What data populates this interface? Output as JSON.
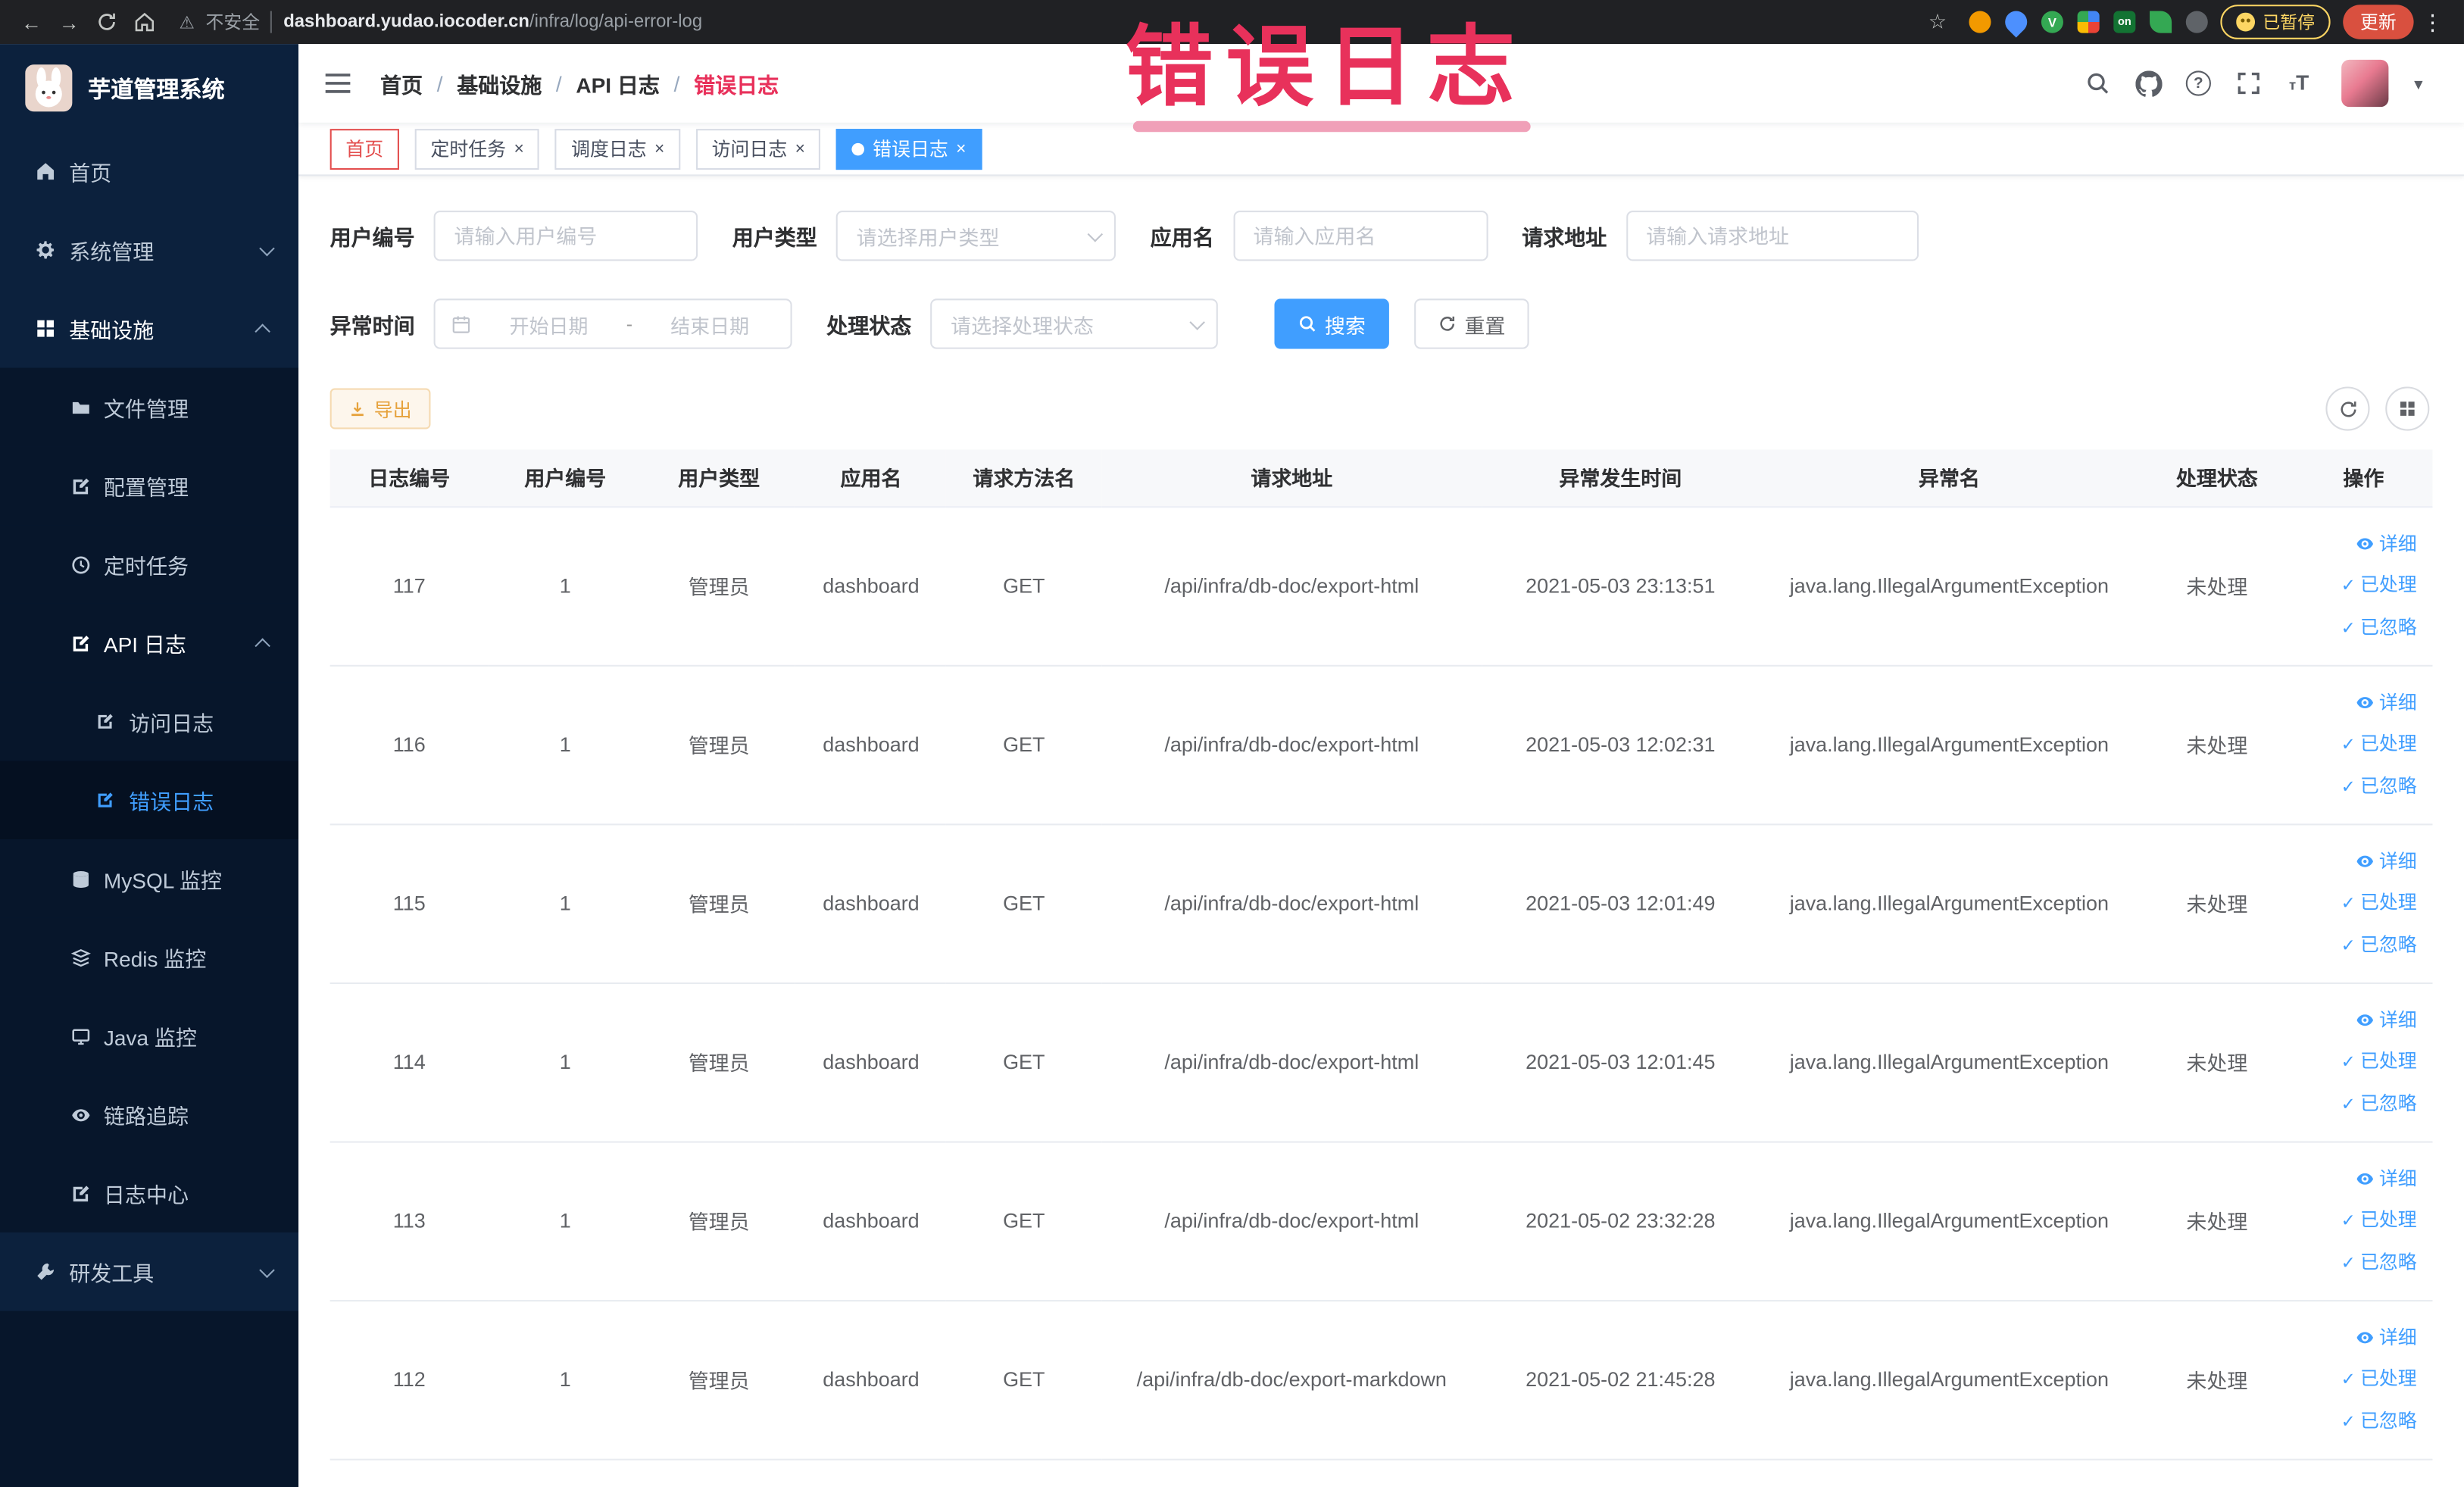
{
  "colors": {
    "accent": "#409eff",
    "annotation": "#e8315b",
    "warning": "#e6a23c",
    "sidebar-bg": "#0c213d",
    "sidebar-sub-bg": "#07162b"
  },
  "annotation": {
    "title": "错误日志"
  },
  "browser": {
    "security_label": "不安全",
    "url_host": "dashboard.yudao.iocoder.cn",
    "url_path": "/infra/log/api-error-log",
    "extension_on_badge": "on",
    "paused_badge": "已暂停",
    "update_label": "更新"
  },
  "sidebar": {
    "logo_title": "芋道管理系统",
    "home": "首页",
    "system_mgmt": "系统管理",
    "infrastructure": "基础设施",
    "file_mgmt": "文件管理",
    "config_mgmt": "配置管理",
    "scheduled_jobs": "定时任务",
    "api_log": "API 日志",
    "access_log": "访问日志",
    "error_log": "错误日志",
    "mysql_monitor": "MySQL 监控",
    "redis_monitor": "Redis 监控",
    "java_monitor": "Java 监控",
    "tracing": "链路追踪",
    "log_center": "日志中心",
    "dev_tools": "研发工具"
  },
  "breadcrumb": {
    "separator": "/",
    "items": [
      "首页",
      "基础设施",
      "API 日志",
      "错误日志"
    ]
  },
  "tags": {
    "home": "首页",
    "job": "定时任务",
    "job_log": "调度日志",
    "access_log": "访问日志",
    "error_log": "错误日志"
  },
  "filters": {
    "user_id": {
      "label": "用户编号",
      "placeholder": "请输入用户编号"
    },
    "user_type": {
      "label": "用户类型",
      "placeholder": "请选择用户类型"
    },
    "app_name": {
      "label": "应用名",
      "placeholder": "请输入应用名"
    },
    "request_url": {
      "label": "请求地址",
      "placeholder": "请输入请求地址"
    },
    "exception_time": {
      "label": "异常时间",
      "start_placeholder": "开始日期",
      "end_placeholder": "结束日期",
      "separator": "-"
    },
    "process_status": {
      "label": "处理状态",
      "placeholder": "请选择处理状态"
    },
    "search_label": "搜索",
    "reset_label": "重置"
  },
  "toolbar": {
    "export_label": "导出"
  },
  "table": {
    "columns": [
      "日志编号",
      "用户编号",
      "用户类型",
      "应用名",
      "请求方法名",
      "请求地址",
      "异常发生时间",
      "异常名",
      "处理状态",
      "操作"
    ],
    "actions": {
      "detail": "详细",
      "processed": "已处理",
      "ignored": "已忽略"
    },
    "rows": [
      {
        "id": "117",
        "user_id": "1",
        "user_type": "管理员",
        "app_name": "dashboard",
        "method": "GET",
        "url": "/api/infra/db-doc/export-html",
        "time": "2021-05-03 23:13:51",
        "exception": "java.lang.IllegalArgumentException",
        "status": "未处理"
      },
      {
        "id": "116",
        "user_id": "1",
        "user_type": "管理员",
        "app_name": "dashboard",
        "method": "GET",
        "url": "/api/infra/db-doc/export-html",
        "time": "2021-05-03 12:02:31",
        "exception": "java.lang.IllegalArgumentException",
        "status": "未处理"
      },
      {
        "id": "115",
        "user_id": "1",
        "user_type": "管理员",
        "app_name": "dashboard",
        "method": "GET",
        "url": "/api/infra/db-doc/export-html",
        "time": "2021-05-03 12:01:49",
        "exception": "java.lang.IllegalArgumentException",
        "status": "未处理"
      },
      {
        "id": "114",
        "user_id": "1",
        "user_type": "管理员",
        "app_name": "dashboard",
        "method": "GET",
        "url": "/api/infra/db-doc/export-html",
        "time": "2021-05-03 12:01:45",
        "exception": "java.lang.IllegalArgumentException",
        "status": "未处理"
      },
      {
        "id": "113",
        "user_id": "1",
        "user_type": "管理员",
        "app_name": "dashboard",
        "method": "GET",
        "url": "/api/infra/db-doc/export-html",
        "time": "2021-05-02 23:32:28",
        "exception": "java.lang.IllegalArgumentException",
        "status": "未处理"
      },
      {
        "id": "112",
        "user_id": "1",
        "user_type": "管理员",
        "app_name": "dashboard",
        "method": "GET",
        "url": "/api/infra/db-doc/export-markdown",
        "time": "2021-05-02 21:45:28",
        "exception": "java.lang.IllegalArgumentException",
        "status": "未处理"
      }
    ]
  }
}
